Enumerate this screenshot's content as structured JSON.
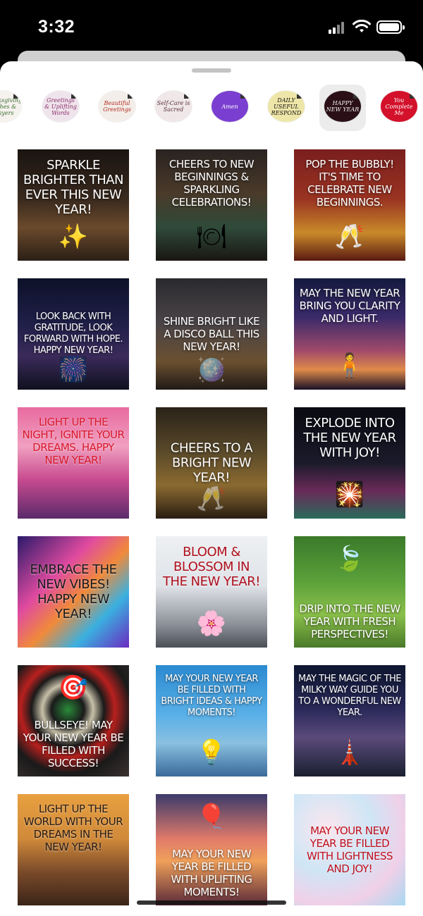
{
  "status": {
    "time": "3:32"
  },
  "stickers": [
    {
      "label": "Thanksgiving Wishes & Prayers",
      "bg": "#f6f2ee",
      "fg": "#3a6b2f"
    },
    {
      "label": "Greetings & Uplifting Words",
      "bg": "#efe4ec",
      "fg": "#8a2d6b"
    },
    {
      "label": "Beautiful Greetings",
      "bg": "#f3eee9",
      "fg": "#b2281f"
    },
    {
      "label": "Self-Care is Sacred",
      "bg": "#efe7e8",
      "fg": "#5a3040"
    },
    {
      "label": "Amen",
      "bg": "#7a3fd0",
      "fg": "#ffffff"
    },
    {
      "label": "DAILY USEFUL RESPOND",
      "bg": "#eee6a8",
      "fg": "#111111"
    },
    {
      "label": "HAPPY NEW YEAR",
      "bg": "#2a1016",
      "fg": "#f2f2f2"
    },
    {
      "label": "You Complete Me",
      "bg": "#d3112a",
      "fg": "#ffffff"
    }
  ],
  "tiles": [
    {
      "caption": "SPARKLE BRIGHTER THAN EVER THIS NEW YEAR!",
      "capColor": "#ffffff",
      "capPos": "top",
      "bg": "linear-gradient(180deg,#1a1410 0%,#3a2a1e 45%,#6b4a2c 70%,#2b1f16 100%)",
      "glyph": "✨"
    },
    {
      "caption": "CHEERS TO NEW BEGINNINGS & SPARKLING CELEBRATIONS!",
      "capColor": "#ffffff",
      "capPos": "top",
      "bg": "linear-gradient(180deg,#2a2320 0%,#4a3a2a 40%,#2f4a3a 70%,#1a1612 100%)",
      "glyph": "🍽"
    },
    {
      "caption": "POP THE BUBBLY! IT'S TIME TO CELEBRATE NEW BEGINNINGS.",
      "capColor": "#ffffff",
      "capPos": "top",
      "bg": "linear-gradient(180deg,#7a1e1e 0%,#9a3422 45%,#c98a2a 75%,#5a1a12 100%)",
      "glyph": "🥂"
    },
    {
      "caption": "LOOK BACK WITH GRATITUDE, LOOK FORWARD WITH HOPE. HAPPY NEW YEAR!",
      "capColor": "#ffffff",
      "capPos": "mid",
      "bg": "linear-gradient(180deg,#0d1128 0%,#1f1f48 40%,#3a2a5a 70%,#10101e 100%)",
      "glyph": "🎆"
    },
    {
      "caption": "SHINE BRIGHT LIKE A DISCO BALL THIS NEW YEAR!",
      "capColor": "#ffffff",
      "capPos": "mid",
      "bg": "linear-gradient(180deg,#2a2a2e 0%,#4a4448 40%,#6a5030 75%,#201a16 100%)",
      "glyph": "🪩"
    },
    {
      "caption": "MAY THE NEW YEAR BRING YOU CLARITY AND LIGHT.",
      "capColor": "#ffffff",
      "capPos": "top",
      "bg": "linear-gradient(180deg,#141a3e 0%,#3a2a6a 35%,#a04a6a 65%,#e08a4a 82%,#1a1226 100%)",
      "glyph": "🧍"
    },
    {
      "caption": "LIGHT UP THE NIGHT, IGNITE YOUR DREAMS. HAPPY NEW YEAR!",
      "capColor": "#d8182a",
      "capPos": "top",
      "bg": "linear-gradient(180deg,#e86aa0 0%,#f0a0c0 35%,#c84a90 65%,#5a2a6a 100%)",
      "glyph": ""
    },
    {
      "caption": "CHEERS TO A BRIGHT NEW YEAR!",
      "capColor": "#ffffff",
      "capPos": "mid",
      "bg": "linear-gradient(180deg,#2a2218 0%,#5a4a2a 40%,#8a6a30 70%,#2a1e12 100%)",
      "glyph": "🥂"
    },
    {
      "caption": "EXPLODE INTO THE NEW YEAR WITH JOY!",
      "capColor": "#ffffff",
      "capPos": "top",
      "bg": "linear-gradient(180deg,#0a0a12 0%,#1a1a2a 50%,#6a2a5a 75%,#2a6a5a 100%)",
      "glyph": "🎇"
    },
    {
      "caption": "EMBRACE THE NEW VIBES! HAPPY NEW YEAR!",
      "capColor": "#1a1a1a",
      "capPos": "mid",
      "bg": "linear-gradient(135deg,#2a1a6a 0%,#e04aa0 35%,#f08a3a 55%,#3ab0e0 75%,#6a2ac0 100%)",
      "glyph": ""
    },
    {
      "caption": "BLOOM & BLOSSOM IN THE NEW YEAR!",
      "capColor": "#b0101e",
      "capPos": "top",
      "bg": "linear-gradient(180deg,#eef0f2 0%,#dfe3e8 45%,#8a8e96 80%,#4a4e56 100%)",
      "glyph": "🌸"
    },
    {
      "caption": "DRIP INTO THE NEW YEAR WITH FRESH PERSPECTIVES!",
      "capColor": "#ffffff",
      "capPos": "bottom",
      "bg": "linear-gradient(180deg,#3a7a2a 0%,#5aa03a 40%,#8ac04a 70%,#4a7a2a 100%)",
      "glyph": "🍃"
    },
    {
      "caption": "BULLSEYE! MAY YOUR NEW YEAR BE FILLED WITH SUCCESS!",
      "capColor": "#ffffff",
      "capPos": "bottom",
      "bg": "radial-gradient(circle at 45% 40%,#2a8a3a 0%,#1a1a1a 18%,#c8c0a8 28%,#1a1a1a 40%,#b8201e 52%,#1a1a1a 70%,#3a3230 100%)",
      "glyph": "🎯"
    },
    {
      "caption": "MAY YOUR NEW YEAR BE FILLED WITH BRIGHT IDEAS & HAPPY MOMENTS!",
      "capColor": "#ffffff",
      "capPos": "top",
      "bg": "linear-gradient(180deg,#2a8ad0 0%,#5ab0e8 45%,#8ac0e0 70%,#3a6a9a 100%)",
      "glyph": "💡"
    },
    {
      "caption": "MAY THE MAGIC OF THE MILKY WAY GUIDE YOU TO A WONDERFUL NEW YEAR.",
      "capColor": "#ffffff",
      "capPos": "top",
      "bg": "linear-gradient(180deg,#0e1630 0%,#2a2a5a 40%,#5a4a7a 65%,#1a2030 100%)",
      "glyph": "🗼"
    },
    {
      "caption": "LIGHT UP THE WORLD WITH YOUR DREAMS IN THE NEW YEAR!",
      "capColor": "#2a1a10",
      "capPos": "top",
      "bg": "linear-gradient(180deg,#e8a040 0%,#d08a3a 40%,#7a4a2a 70%,#3a2418 100%)",
      "glyph": ""
    },
    {
      "caption": "MAY YOUR NEW YEAR BE FILLED WITH UPLIFTING MOMENTS!",
      "capColor": "#ffffff",
      "capPos": "bottom",
      "bg": "linear-gradient(180deg,#3a3a6a 0%,#e07a6a 40%,#f0a05a 60%,#5a2a3a 100%)",
      "glyph": "🎈"
    },
    {
      "caption": "MAY YOUR NEW YEAR BE FILLED WITH LIGHTNESS AND JOY!",
      "capColor": "#c0101e",
      "capPos": "mid",
      "bg": "radial-gradient(circle at 30% 30%,#fbe6ee 0%,#cfe6f6 40%,#f0d0e8 70%,#a8d8f0 100%)",
      "glyph": ""
    }
  ]
}
